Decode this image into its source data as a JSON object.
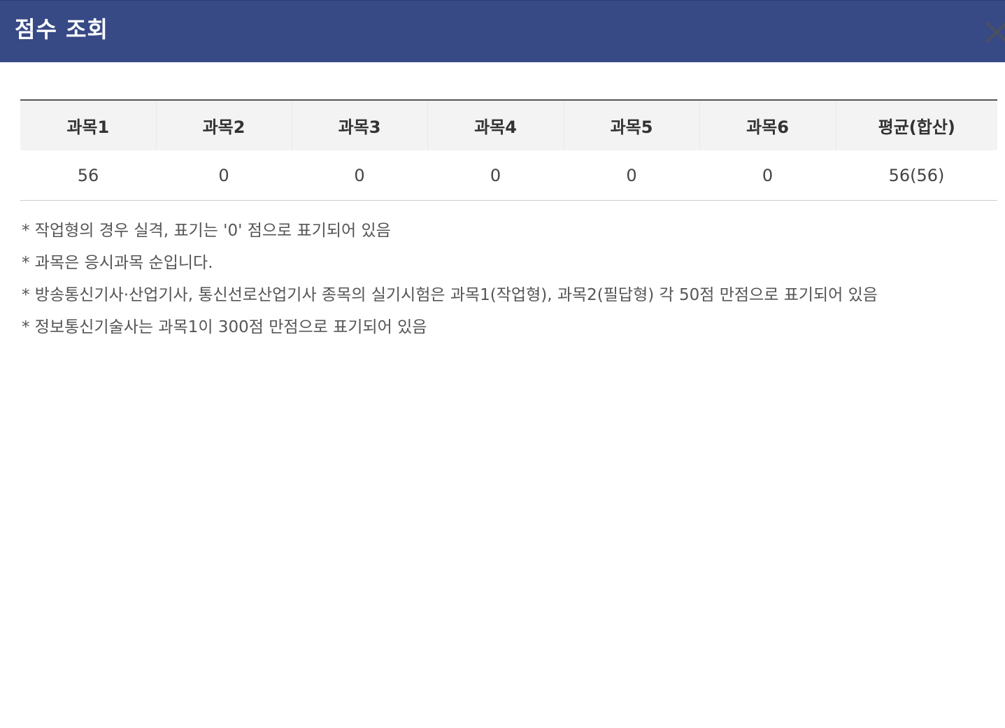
{
  "modal": {
    "title": "점수 조회",
    "close_icon": "close-icon"
  },
  "table": {
    "headers": [
      "과목1",
      "과목2",
      "과목3",
      "과목4",
      "과목5",
      "과목6",
      "평균(합산)"
    ],
    "rows": [
      [
        "56",
        "0",
        "0",
        "0",
        "0",
        "0",
        "56(56)"
      ]
    ]
  },
  "notes": [
    "* 작업형의 경우 실격, 표기는 '0' 점으로 표기되어 있음",
    "* 과목은 응시과목 순입니다.",
    "* 방송통신기사·산업기사, 통신선로산업기사 종목의 실기시험은 과목1(작업형), 과목2(필답형) 각 50점 만점으로 표기되어 있음",
    "* 정보통신기술사는 과목1이 300점 만점으로 표기되어 있음"
  ],
  "colors": {
    "header_bg": "#374a86",
    "title_text": "#ffffff",
    "table_header_bg": "#f3f3f3"
  }
}
